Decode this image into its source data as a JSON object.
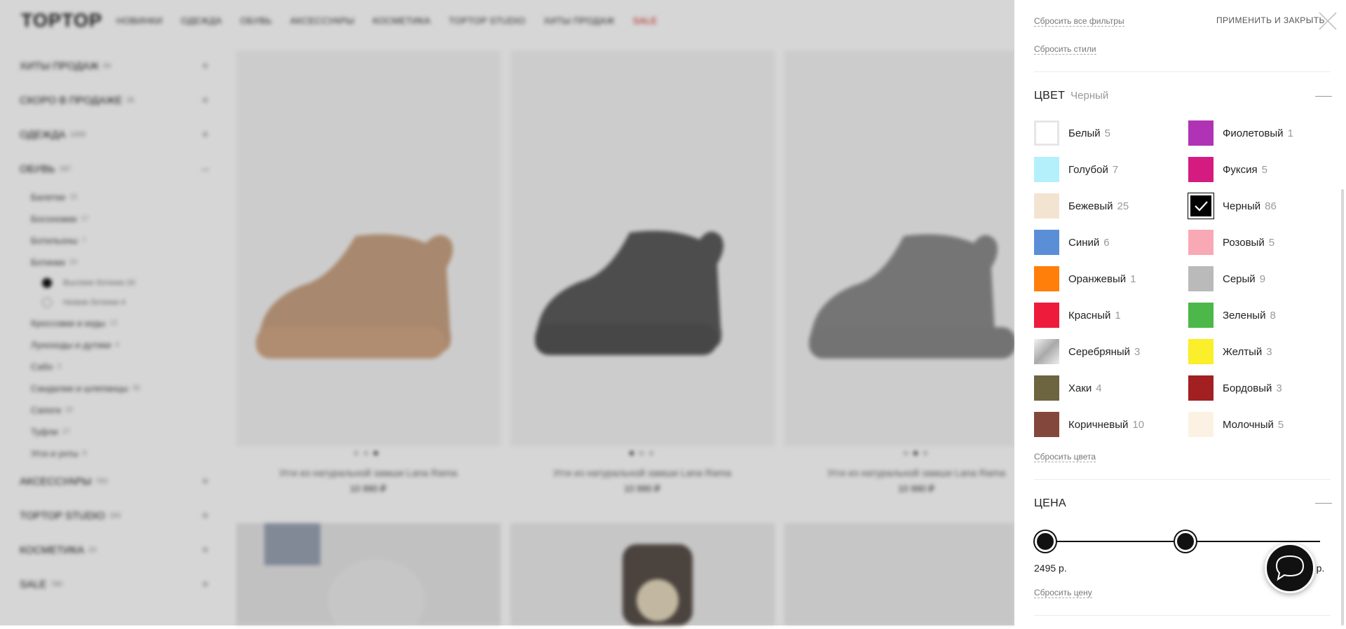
{
  "header": {
    "logo": "TOPTOP",
    "nav": [
      "НОВИНКИ",
      "ОДЕЖДА",
      "ОБУВЬ",
      "АКСЕССУАРЫ",
      "КОСМЕТИКА",
      "TOPTOP STUDIO",
      "ХИТЫ ПРОДАЖ",
      "SALE"
    ]
  },
  "sidebar": {
    "top_categories": [
      {
        "label": "ХИТЫ ПРОДАЖ",
        "count": "64"
      },
      {
        "label": "СКОРО В ПРОДАЖЕ",
        "count": "35"
      },
      {
        "label": "ОДЕЖДА",
        "count": "1008"
      },
      {
        "label": "ОБУВЬ",
        "count": "187"
      }
    ],
    "shoes_sub": [
      {
        "label": "Балетки",
        "count": "15"
      },
      {
        "label": "Босоножки",
        "count": "17"
      },
      {
        "label": "Ботильоны",
        "count": "7"
      },
      {
        "label": "Ботинки",
        "count": "24"
      }
    ],
    "boots_sub": [
      {
        "label": "Высокие ботинки",
        "count": "20"
      },
      {
        "label": "Низкие ботинки",
        "count": "4"
      }
    ],
    "shoes_sub2": [
      {
        "label": "Кроссовки и кеды",
        "count": "12"
      },
      {
        "label": "Луноходы и дутики",
        "count": "4"
      },
      {
        "label": "Сабо",
        "count": "3"
      },
      {
        "label": "Сандалии и шлепанцы",
        "count": "35"
      },
      {
        "label": "Сапоги",
        "count": "20"
      },
      {
        "label": "Туфли",
        "count": "27"
      },
      {
        "label": "Угги и унты",
        "count": "8"
      }
    ],
    "bottom_categories": [
      {
        "label": "АКСЕССУАРЫ",
        "count": "763"
      },
      {
        "label": "TOPTOP STUDIO",
        "count": "184"
      },
      {
        "label": "КОСМЕТИКА",
        "count": "24"
      },
      {
        "label": "SALE",
        "count": "780"
      }
    ]
  },
  "products": [
    {
      "title": "Угги из натуральной замши Lana Rama",
      "price": "10 990 ₽"
    },
    {
      "title": "Угги из натуральной замши Lana Rama",
      "price": "10 990 ₽"
    },
    {
      "title": "Угги из натуральной замши Lana Rama",
      "price": "10 990 ₽"
    }
  ],
  "filter": {
    "reset_all": "Сбросить все фильтры",
    "apply_close": "ПРИМЕНИТЬ И ЗАКРЫТЬ",
    "reset_styles": "Сбросить стили",
    "color": {
      "title": "ЦВЕТ",
      "selected": "Черный",
      "reset": "Сбросить цвета",
      "left": [
        {
          "name": "Белый",
          "count": "5",
          "hex": "#ffffff"
        },
        {
          "name": "Голубой",
          "count": "7",
          "hex": "#b3f0fb"
        },
        {
          "name": "Бежевый",
          "count": "25",
          "hex": "#f3e3d1"
        },
        {
          "name": "Синий",
          "count": "6",
          "hex": "#5a8fd8"
        },
        {
          "name": "Оранжевый",
          "count": "1",
          "hex": "#ff7f0a"
        },
        {
          "name": "Красный",
          "count": "1",
          "hex": "#ee1b3a"
        },
        {
          "name": "Серебряный",
          "count": "3",
          "hex": "#c8c8c8"
        },
        {
          "name": "Хаки",
          "count": "4",
          "hex": "#6c6540"
        },
        {
          "name": "Коричневый",
          "count": "10",
          "hex": "#84473b"
        }
      ],
      "right": [
        {
          "name": "Фиолетовый",
          "count": "1",
          "hex": "#b033b5"
        },
        {
          "name": "Фуксия",
          "count": "5",
          "hex": "#d61b80"
        },
        {
          "name": "Черный",
          "count": "86",
          "hex": "#000000",
          "checked": true
        },
        {
          "name": "Розовый",
          "count": "5",
          "hex": "#f9a8b5"
        },
        {
          "name": "Серый",
          "count": "9",
          "hex": "#bababa"
        },
        {
          "name": "Зеленый",
          "count": "8",
          "hex": "#4cb849"
        },
        {
          "name": "Желтый",
          "count": "3",
          "hex": "#fbee2a"
        },
        {
          "name": "Бордовый",
          "count": "3",
          "hex": "#a21f22"
        },
        {
          "name": "Молочный",
          "count": "5",
          "hex": "#fcf2e4"
        }
      ]
    },
    "price": {
      "title": "ЦЕНА",
      "min_label": "2495 р.",
      "max_label_visible": "0 р.",
      "reset": "Сбросить цену"
    }
  }
}
